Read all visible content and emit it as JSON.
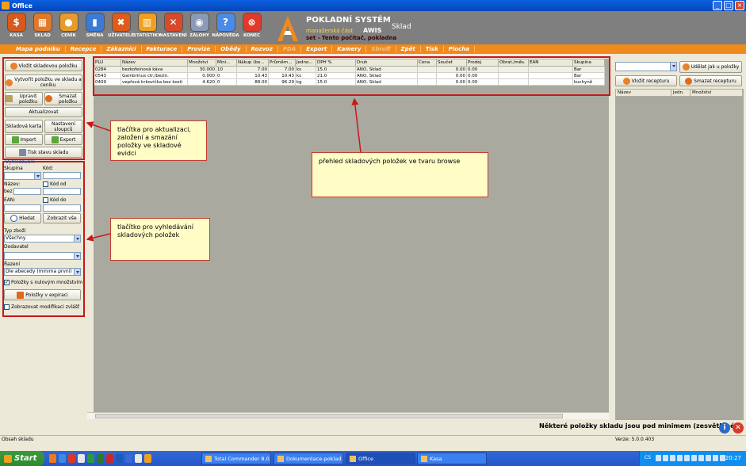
{
  "window": {
    "title": "Office"
  },
  "toolbar": [
    {
      "label": "KASA",
      "icon": "cash-register-icon",
      "color": "#d85a1a",
      "glyph": "$"
    },
    {
      "label": "SKLAD",
      "icon": "warehouse-icon",
      "color": "#e07a2a",
      "glyph": "▦"
    },
    {
      "label": "CENÍK",
      "icon": "price-list-icon",
      "color": "#e89a2a",
      "glyph": "●"
    },
    {
      "label": "SMĚNA",
      "icon": "shift-icon",
      "color": "#3a7ad8",
      "glyph": "▮"
    },
    {
      "label": "UŽIVATELÉ",
      "icon": "users-icon",
      "color": "#e05a1a",
      "glyph": "✖"
    },
    {
      "label": "STATISTIKY",
      "icon": "statistics-icon",
      "color": "#f0a020",
      "glyph": "▥"
    },
    {
      "label": "NASTAVENÍ",
      "icon": "settings-icon",
      "color": "#d84a2a",
      "glyph": "✕"
    },
    {
      "label": "ZÁLOHY",
      "icon": "backup-icon",
      "color": "#8a9ab8",
      "glyph": "◉"
    },
    {
      "label": "NÁPOVĚDA",
      "icon": "help-icon",
      "color": "#4a8ae8",
      "glyph": "?"
    },
    {
      "label": "KONEC",
      "icon": "exit-icon",
      "color": "#e03a2a",
      "glyph": "⊗"
    }
  ],
  "brand": {
    "title": "POKLADNÍ SYSTÉM",
    "subtitle": "manažerská část",
    "name": "AWIS",
    "station": "set - Tento počítač, pokladna",
    "module": "Sklad"
  },
  "menu": [
    {
      "label": "Mapa podniku",
      "disabled": false
    },
    {
      "label": "Recepce",
      "disabled": false
    },
    {
      "label": "Zákazníci",
      "disabled": false
    },
    {
      "label": "Fakturace",
      "disabled": false
    },
    {
      "label": "Provize",
      "disabled": false
    },
    {
      "label": "Obědy",
      "disabled": false
    },
    {
      "label": "Rozvoz",
      "disabled": false
    },
    {
      "label": "PDA",
      "disabled": true
    },
    {
      "label": "Export",
      "disabled": false
    },
    {
      "label": "Kamery",
      "disabled": false
    },
    {
      "label": "Sbroff",
      "disabled": true
    },
    {
      "label": "Zpět",
      "disabled": false
    },
    {
      "label": "Tisk",
      "disabled": false
    },
    {
      "label": "Plocha",
      "disabled": false
    }
  ],
  "left": {
    "add_item": "Vložit skladovou položku",
    "create_item_stock_price": "Vytvořit položku ve skladu a ceníku",
    "edit_item": "Upravit položku",
    "delete_item": "Smazat položku",
    "refresh": "Aktualizovat",
    "stock_card": "Skladová karta",
    "column_settings": "Nastavení sloupců",
    "import": "Import",
    "export": "Export",
    "print_stock": "Tisk stavu skladu",
    "search_header": "Vyhledávání",
    "group_label": "Skupina",
    "code_label": "Kód:",
    "name_label": "Název:",
    "code_from_label": "Kód od",
    "without_label": "bez",
    "ean_label": "EAN:",
    "code_to_label": "Kód do",
    "search_btn": "Hledat",
    "show_all_btn": "Zobrazit vše",
    "goods_type_label": "Typ zboží",
    "goods_type_value": "Všechny",
    "supplier_label": "Dodavatel",
    "supplier_value": "",
    "sort_label": "Řazení",
    "sort_value": "Dle abecedy (minima první)",
    "zero_qty_label": "Položky s nulovým množstvím",
    "zero_qty_checked": true,
    "expired_btn": "Položky v expiraci",
    "show_modifications_label": "Zobrazovat modifikaci zvlášť",
    "show_modifications_checked": false
  },
  "grid": {
    "columns": [
      "PLU",
      "Název",
      "Množství",
      "Mini...",
      "Nákup (be...",
      "Průměrn...",
      "Jedno...",
      "DPH %",
      "Druh",
      "Cena",
      "Součet",
      "Prodej",
      "Obrat./měs.",
      "EAN",
      "Skupina"
    ],
    "rows": [
      [
        "0284",
        "bezkofeinová káva",
        "30.000",
        "10",
        "7.00",
        "7.00",
        "ks",
        "15.0",
        "ANO, Sklad",
        "",
        "0.00",
        "0.00",
        "",
        "",
        "Bar"
      ],
      [
        "0543",
        "Gambrinus ctr./bezin.",
        "0.000",
        "0",
        "10.43",
        "10.43",
        "ks",
        "21.0",
        "ANO, Sklad",
        "",
        "0.00",
        "0.00",
        "",
        "",
        "Bar"
      ],
      [
        "0409",
        "vepřová krkovička bez kosti",
        "4.620",
        "0",
        "88.00",
        "96.29",
        "kg",
        "15.0",
        "ANO, Sklad",
        "",
        "0.00",
        "0.00",
        "",
        "",
        "kuchyně"
      ]
    ]
  },
  "right": {
    "make_item_btn": "Udělat jak u položky",
    "add_recipe_btn": "Vložit recepturu",
    "delete_recipe_btn": "Smazat recepturu",
    "select_value": "",
    "columns": [
      "Název",
      "Jedn.",
      "Množství"
    ]
  },
  "callouts": {
    "buttons": "tlačítka pro aktualizaci, založení a smazání položky ve skladové evidci",
    "search": "tlačítko pro vyhledávání skladových položek",
    "browse": "přehled skladových položek ve tvaru browse"
  },
  "warning": "Některé položky skladu jsou pod minimem (zesvětlené)",
  "status": {
    "left": "Obsah skladu",
    "version": "Verze: 5.0.0.403"
  },
  "taskbar": {
    "start": "Start",
    "tasks": [
      {
        "label": "Total Commander 8.0...",
        "active": false
      },
      {
        "label": "Dokumentace-poklad...",
        "active": false
      },
      {
        "label": "Office",
        "active": true
      },
      {
        "label": "Kasa",
        "active": false
      }
    ],
    "lang": "CS",
    "clock": "20:27"
  }
}
